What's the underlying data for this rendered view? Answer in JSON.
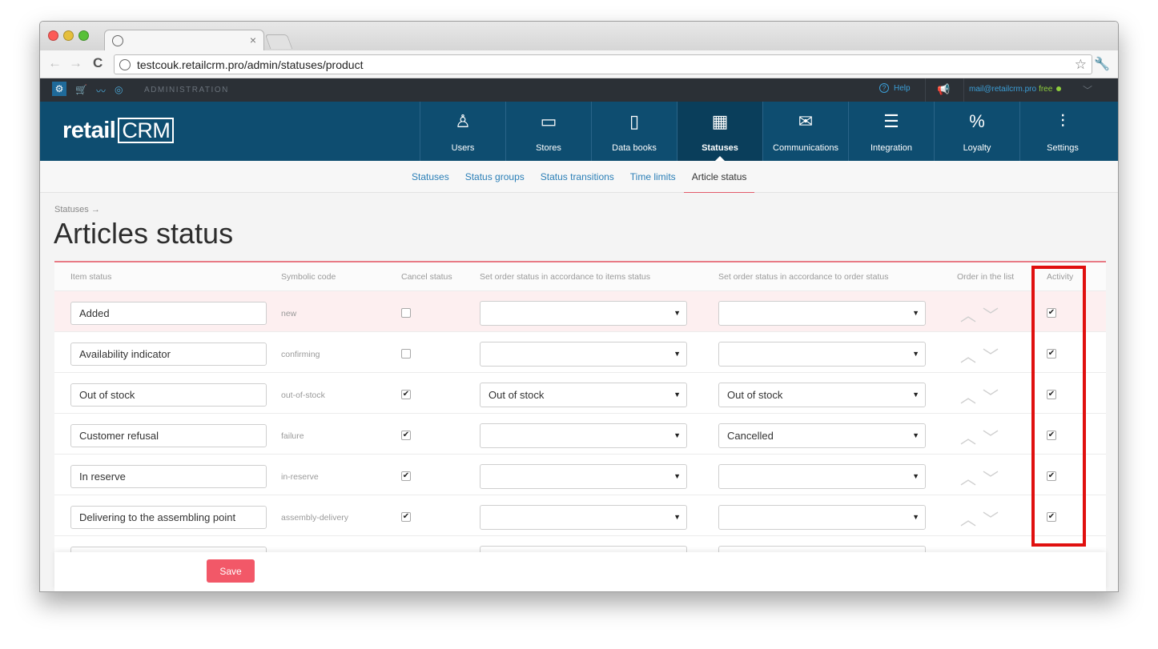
{
  "browser": {
    "url": "testcouk.retailcrm.pro/admin/statuses/product"
  },
  "adminbar": {
    "label": "ADMINISTRATION",
    "help": "Help",
    "email": "mail@retailcrm.pro",
    "plan": "free"
  },
  "logo": {
    "text": "retail",
    "crm": "CRM"
  },
  "mainnav": [
    {
      "label": "Users",
      "icon": "user-icon"
    },
    {
      "label": "Stores",
      "icon": "store-icon"
    },
    {
      "label": "Data books",
      "icon": "book-icon"
    },
    {
      "label": "Statuses",
      "icon": "statuses-icon"
    },
    {
      "label": "Communications",
      "icon": "envelope-icon"
    },
    {
      "label": "Integration",
      "icon": "integration-icon"
    },
    {
      "label": "Loyalty",
      "icon": "percent-tag-icon"
    },
    {
      "label": "Settings",
      "icon": "sliders-icon"
    }
  ],
  "subnav": [
    "Statuses",
    "Status groups",
    "Status transitions",
    "Time limits",
    "Article status"
  ],
  "breadcrumb": "Statuses →",
  "page_title": "Articles status",
  "table": {
    "headers": {
      "item_status": "Item status",
      "symbolic_code": "Symbolic code",
      "cancel_status": "Cancel status",
      "set_by_items": "Set order status in accordance to items status",
      "set_by_order": "Set order status in accordance to order status",
      "order_in_list": "Order in the list",
      "activity": "Activity"
    },
    "rows": [
      {
        "name": "Added",
        "code": "new",
        "cancel": false,
        "by_items": "",
        "by_order": "",
        "active": true
      },
      {
        "name": "Availability indicator",
        "code": "confirming",
        "cancel": false,
        "by_items": "",
        "by_order": "",
        "active": true
      },
      {
        "name": "Out of stock",
        "code": "out-of-stock",
        "cancel": true,
        "by_items": "Out of stock",
        "by_order": "Out of stock",
        "active": true
      },
      {
        "name": "Customer refusal",
        "code": "failure",
        "cancel": true,
        "by_items": "",
        "by_order": "Cancelled",
        "active": true
      },
      {
        "name": "In reserve",
        "code": "in-reserve",
        "cancel": true,
        "by_items": "",
        "by_order": "",
        "active": true
      },
      {
        "name": "Delivering to the assembling point",
        "code": "assembly-delivery",
        "cancel": true,
        "by_items": "",
        "by_order": "",
        "active": true
      }
    ]
  },
  "save_label": "Save"
}
